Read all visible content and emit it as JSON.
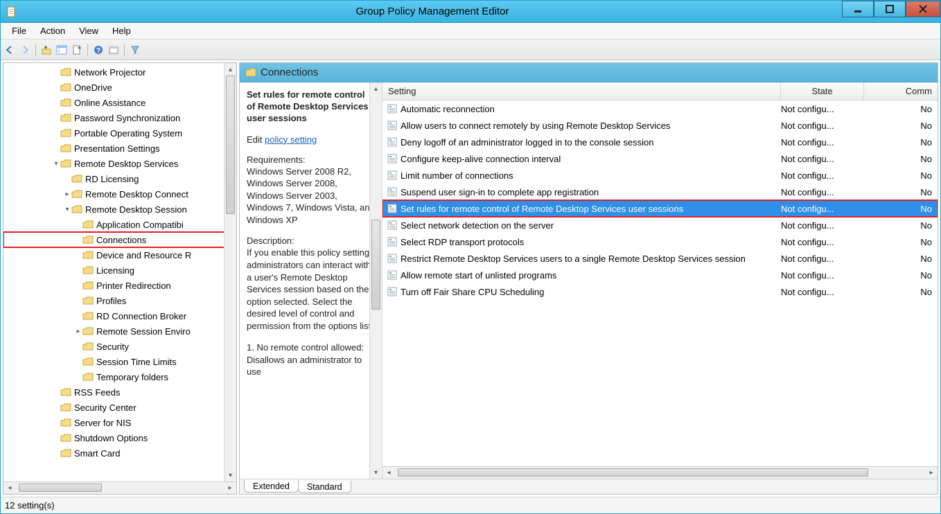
{
  "window": {
    "title": "Group Policy Management Editor"
  },
  "menu": {
    "file": "File",
    "action": "Action",
    "view": "View",
    "help": "Help"
  },
  "tree": {
    "items": [
      {
        "indent": 4,
        "exp": "",
        "label": "Network Projector"
      },
      {
        "indent": 4,
        "exp": "",
        "label": "OneDrive"
      },
      {
        "indent": 4,
        "exp": "",
        "label": "Online Assistance"
      },
      {
        "indent": 4,
        "exp": "",
        "label": "Password Synchronization"
      },
      {
        "indent": 4,
        "exp": "",
        "label": "Portable Operating System"
      },
      {
        "indent": 4,
        "exp": "",
        "label": "Presentation Settings"
      },
      {
        "indent": 4,
        "exp": "▾",
        "label": "Remote Desktop Services"
      },
      {
        "indent": 5,
        "exp": "",
        "label": "RD Licensing"
      },
      {
        "indent": 5,
        "exp": "▸",
        "label": "Remote Desktop Connect"
      },
      {
        "indent": 5,
        "exp": "▾",
        "label": "Remote Desktop Session"
      },
      {
        "indent": 6,
        "exp": "",
        "label": "Application Compatibi"
      },
      {
        "indent": 6,
        "exp": "",
        "label": "Connections",
        "hl": true
      },
      {
        "indent": 6,
        "exp": "",
        "label": "Device and Resource R"
      },
      {
        "indent": 6,
        "exp": "",
        "label": "Licensing"
      },
      {
        "indent": 6,
        "exp": "",
        "label": "Printer Redirection"
      },
      {
        "indent": 6,
        "exp": "",
        "label": "Profiles"
      },
      {
        "indent": 6,
        "exp": "",
        "label": "RD Connection Broker"
      },
      {
        "indent": 6,
        "exp": "▸",
        "label": "Remote Session Enviro"
      },
      {
        "indent": 6,
        "exp": "",
        "label": "Security"
      },
      {
        "indent": 6,
        "exp": "",
        "label": "Session Time Limits"
      },
      {
        "indent": 6,
        "exp": "",
        "label": "Temporary folders"
      },
      {
        "indent": 4,
        "exp": "",
        "label": "RSS Feeds"
      },
      {
        "indent": 4,
        "exp": "",
        "label": "Security Center"
      },
      {
        "indent": 4,
        "exp": "",
        "label": "Server for NIS"
      },
      {
        "indent": 4,
        "exp": "",
        "label": "Shutdown Options"
      },
      {
        "indent": 4,
        "exp": "",
        "label": "Smart Card"
      }
    ]
  },
  "right": {
    "header": "Connections",
    "desc": {
      "selected_title": "Set rules for remote control of Remote Desktop Services user sessions",
      "edit_label": "Edit",
      "edit_link": "policy setting",
      "req_title": "Requirements:",
      "req_body": "Windows Server 2008 R2, Windows Server 2008, Windows Server 2003, Windows 7, Windows Vista, and Windows XP",
      "desc_title": "Description:",
      "desc_body": "If you enable this policy setting, administrators can interact with a user's Remote Desktop Services session based on the option selected. Select the desired level of control and permission from the options list:",
      "desc_more": "1. No remote control allowed: Disallows an administrator to use"
    },
    "columns": {
      "setting": "Setting",
      "state": "State",
      "comment": "Comm"
    },
    "rows": [
      {
        "setting": "Automatic reconnection",
        "state": "Not configu...",
        "comment": "No"
      },
      {
        "setting": "Allow users to connect remotely by using Remote Desktop Services",
        "state": "Not configu...",
        "comment": "No"
      },
      {
        "setting": "Deny logoff of an administrator logged in to the console session",
        "state": "Not configu...",
        "comment": "No"
      },
      {
        "setting": "Configure keep-alive connection interval",
        "state": "Not configu...",
        "comment": "No"
      },
      {
        "setting": "Limit number of connections",
        "state": "Not configu...",
        "comment": "No"
      },
      {
        "setting": "Suspend user sign-in to complete app registration",
        "state": "Not configu...",
        "comment": "No"
      },
      {
        "setting": "Set rules for remote control of Remote Desktop Services user sessions",
        "state": "Not configu...",
        "comment": "No",
        "selected": true,
        "hl": true
      },
      {
        "setting": "Select network detection on the server",
        "state": "Not configu...",
        "comment": "No"
      },
      {
        "setting": "Select RDP transport protocols",
        "state": "Not configu...",
        "comment": "No"
      },
      {
        "setting": "Restrict Remote Desktop Services users to a single Remote Desktop Services session",
        "state": "Not configu...",
        "comment": "No"
      },
      {
        "setting": "Allow remote start of unlisted programs",
        "state": "Not configu...",
        "comment": "No"
      },
      {
        "setting": "Turn off Fair Share CPU Scheduling",
        "state": "Not configu...",
        "comment": "No"
      }
    ],
    "tabs": {
      "extended": "Extended",
      "standard": "Standard"
    }
  },
  "status": {
    "text": "12 setting(s)"
  }
}
